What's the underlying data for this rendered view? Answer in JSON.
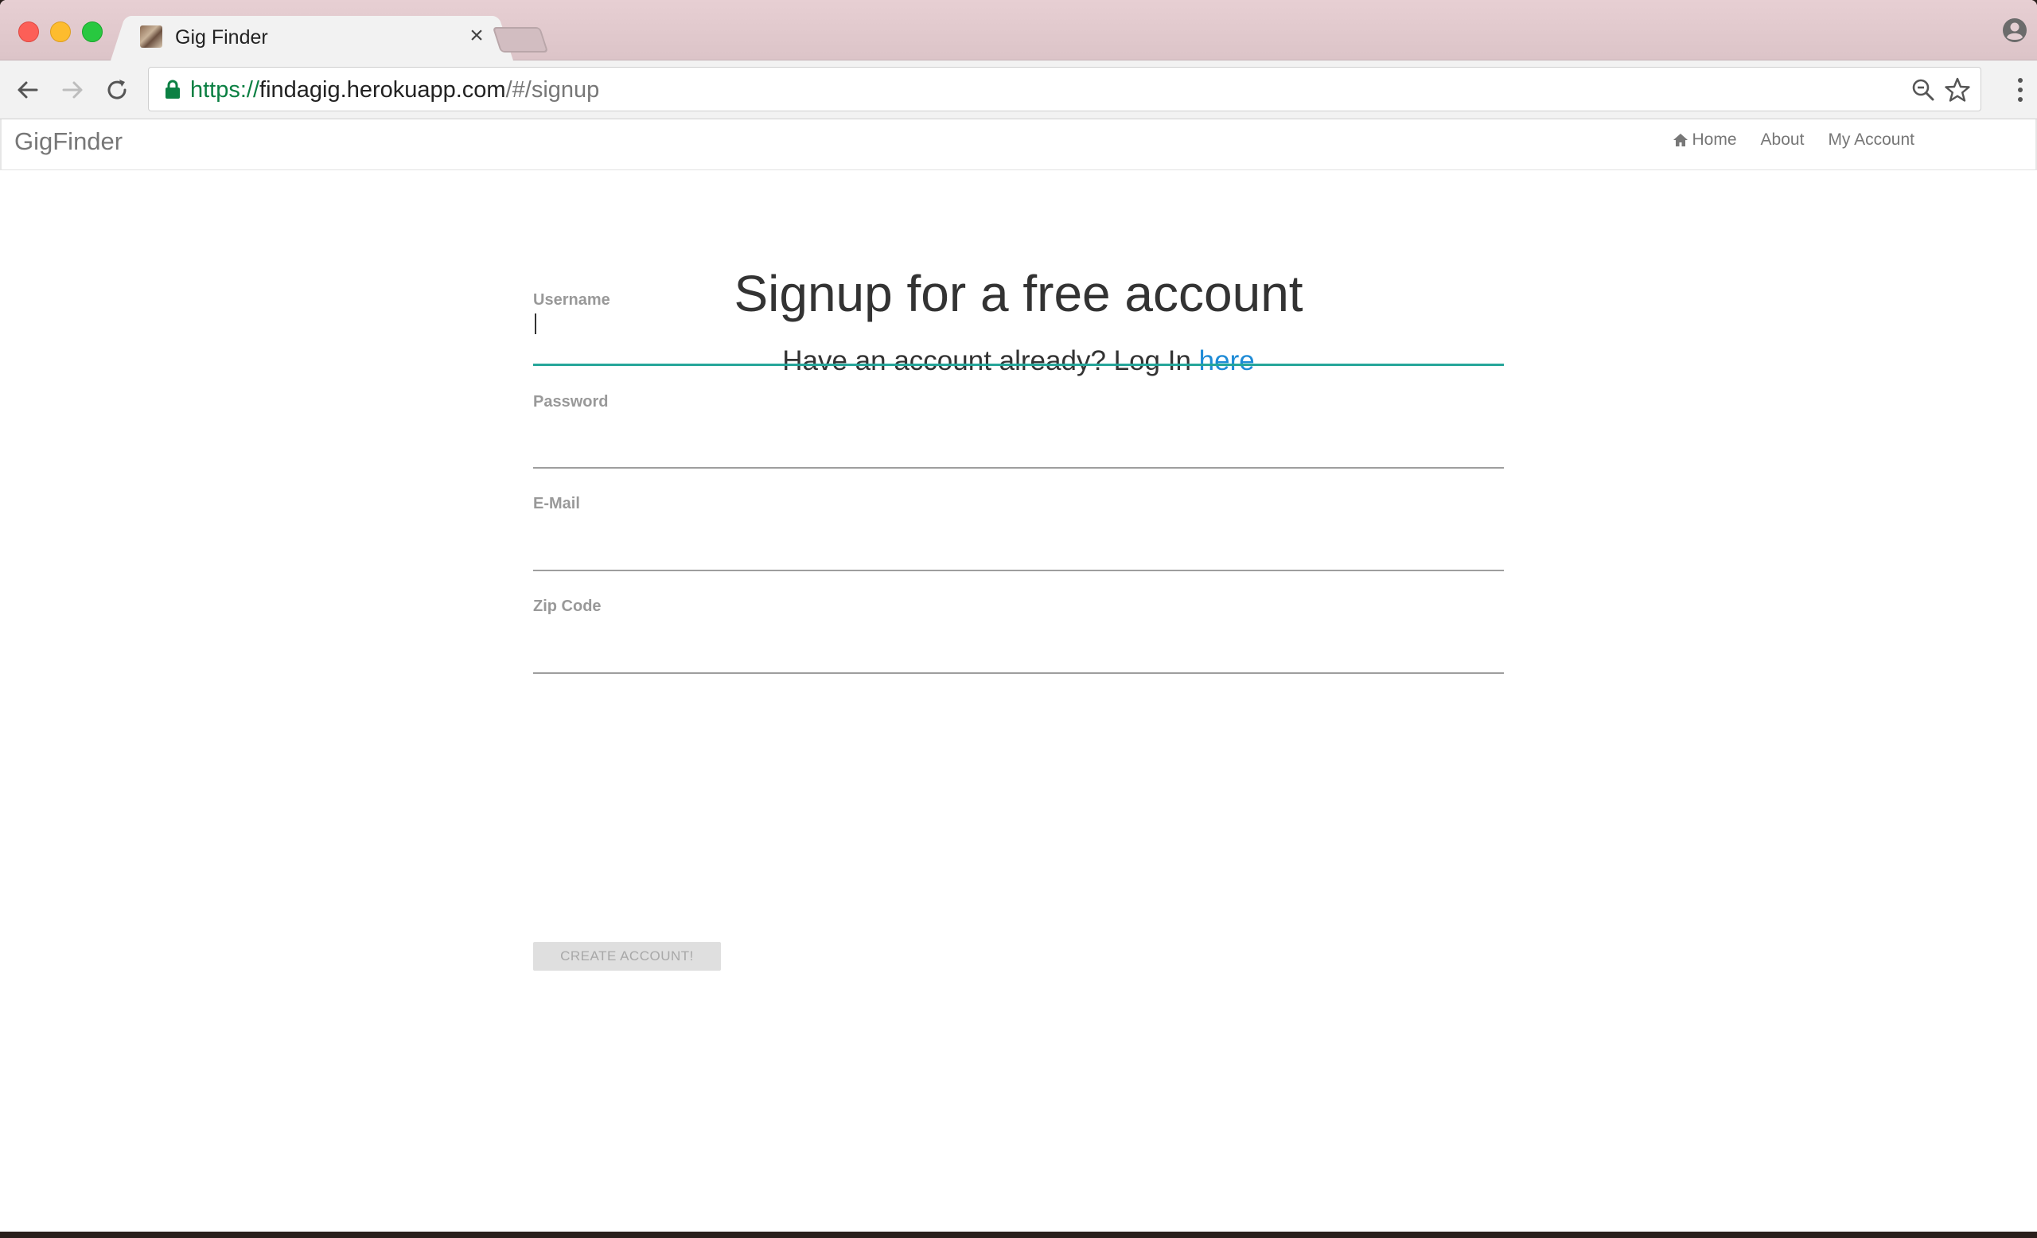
{
  "browser": {
    "tab_title": "Gig Finder",
    "tab_close_glyph": "×",
    "url_scheme": "https://",
    "url_host": "findagig.herokuapp.com",
    "url_path": "/#/signup"
  },
  "navbar": {
    "brand": "GigFinder",
    "links": [
      {
        "label": "Home",
        "icon": "home-icon"
      },
      {
        "label": "About"
      },
      {
        "label": "My Account"
      }
    ]
  },
  "signup": {
    "title": "Signup for a free account",
    "subtitle_prefix": "Have an account already? Log In ",
    "login_link": "here"
  },
  "form": {
    "fields": [
      {
        "label": "Username",
        "value": "",
        "focused": true
      },
      {
        "label": "Password",
        "value": ""
      },
      {
        "label": "E-Mail",
        "value": ""
      },
      {
        "label": "Zip Code",
        "value": ""
      }
    ],
    "submit_label": "CREATE ACCOUNT!"
  },
  "colors": {
    "accent_teal": "#26a69a",
    "link_blue": "#1e8bd6",
    "secure_green": "#0b8043"
  }
}
